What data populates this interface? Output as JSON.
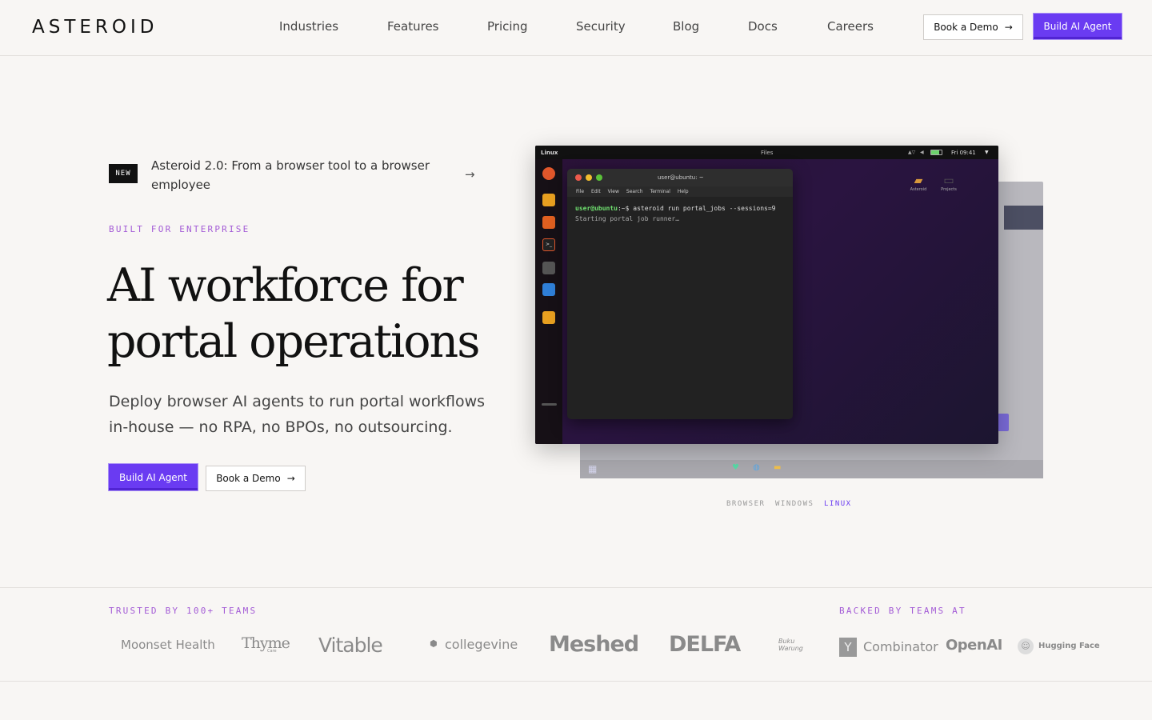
{
  "header": {
    "brand": "ASTEROID",
    "nav": [
      "Industries",
      "Features",
      "Pricing",
      "Security",
      "Blog",
      "Docs",
      "Careers"
    ],
    "book_demo": "Book a Demo",
    "build_agent": "Build AI Agent"
  },
  "hero": {
    "badge": "NEW",
    "announcement": "Asteroid 2.0: From a browser tool to a browser employee",
    "eyebrow": "BUILT FOR ENTERPRISE",
    "headline": "AI workforce for portal operations",
    "subhead": "Deploy browser AI agents to run portal workflows in-house — no RPA, no BPOs, no outsourcing.",
    "cta_primary": "Build AI Agent",
    "cta_secondary": "Book a Demo"
  },
  "demo": {
    "os_label": "Linux",
    "window_title": "Files",
    "clock": "Fri 09:41",
    "terminal_title": "user@ubuntu: ~",
    "terminal_menu": [
      "File",
      "Edit",
      "View",
      "Search",
      "Terminal",
      "Help"
    ],
    "prompt_user": "user@ubuntu",
    "prompt_path": ":~$",
    "command": "asteroid run portal_jobs --sessions=9",
    "output": "Starting portal job runner…",
    "desktop_icons": [
      "Asteroid",
      "Projects"
    ],
    "tabs": [
      "BROWSER",
      "WINDOWS",
      "LINUX"
    ],
    "active_tab": "LINUX"
  },
  "trust": {
    "trusted_label": "TRUSTED BY 100+ TEAMS",
    "backed_label": "BACKED BY TEAMS AT",
    "customers": [
      "Moonset Health",
      "Thyme",
      "Vitable",
      "collegevine",
      "Meshed",
      "DELFA",
      "Buku Warung"
    ],
    "thyme_sub": "Care",
    "backers": [
      "Combinator",
      "OpenAI",
      "Hugging Face"
    ],
    "yc_mark": "Y"
  },
  "colors": {
    "accent": "#6a3bf2",
    "eyebrow": "#a35bd6",
    "bg": "#f8f6f4"
  }
}
